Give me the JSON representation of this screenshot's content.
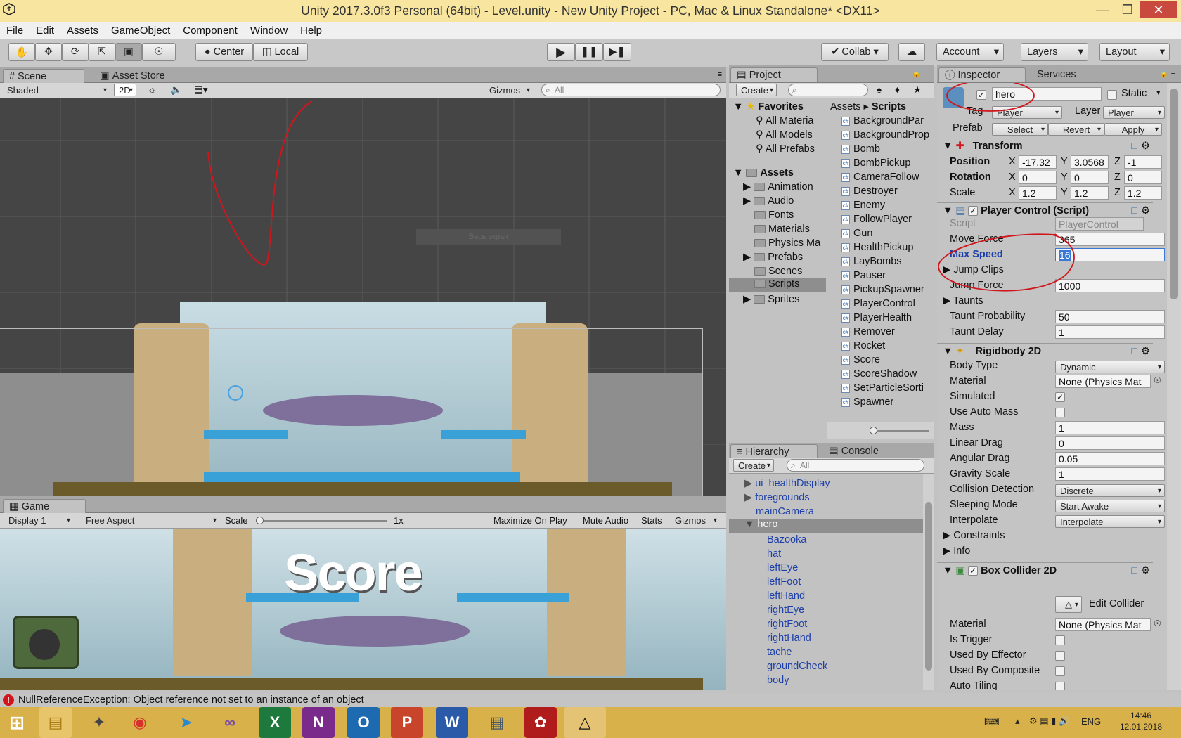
{
  "window": {
    "title": "Unity 2017.3.0f3 Personal (64bit) - Level.unity - New Unity Project - PC, Mac & Linux Standalone* <DX11>"
  },
  "menu": [
    "File",
    "Edit",
    "Assets",
    "GameObject",
    "Component",
    "Window",
    "Help"
  ],
  "toolbar": {
    "center": "Center",
    "local": "Local",
    "collab": "Collab",
    "account": "Account",
    "layers": "Layers",
    "layout": "Layout"
  },
  "scene": {
    "tab": "Scene",
    "asset_store": "Asset Store",
    "shading": "Shaded",
    "mode_2d": "2D",
    "gizmos": "Gizmos",
    "search": "All",
    "overlay_hint": "Весь экран"
  },
  "game": {
    "tab": "Game",
    "display": "Display 1",
    "aspect": "Free Aspect",
    "scale_label": "Scale",
    "scale_value": "1x",
    "maximize": "Maximize On Play",
    "mute": "Mute Audio",
    "stats": "Stats",
    "gizmos": "Gizmos",
    "score_text": "Score"
  },
  "project": {
    "tab": "Project",
    "create": "Create",
    "favorites_label": "Favorites",
    "favorites": [
      "All Materia",
      "All Models",
      "All Prefabs"
    ],
    "assets_label": "Assets",
    "folders": [
      {
        "name": "Animation",
        "arrow": true
      },
      {
        "name": "Audio",
        "arrow": true
      },
      {
        "name": "Fonts",
        "arrow": false
      },
      {
        "name": "Materials",
        "arrow": false
      },
      {
        "name": "Physics Ma",
        "arrow": false
      },
      {
        "name": "Prefabs",
        "arrow": true
      },
      {
        "name": "Scenes",
        "arrow": false
      },
      {
        "name": "Scripts",
        "arrow": false
      },
      {
        "name": "Sprites",
        "arrow": true
      }
    ],
    "breadcrumb_root": "Assets",
    "breadcrumb_current": "Scripts",
    "scripts": [
      "BackgroundPar",
      "BackgroundProp",
      "Bomb",
      "BombPickup",
      "CameraFollow",
      "Destroyer",
      "Enemy",
      "FollowPlayer",
      "Gun",
      "HealthPickup",
      "LayBombs",
      "Pauser",
      "PickupSpawner",
      "PlayerControl",
      "PlayerHealth",
      "Remover",
      "Rocket",
      "Score",
      "ScoreShadow",
      "SetParticleSorti",
      "Spawner"
    ]
  },
  "hierarchy": {
    "tab": "Hierarchy",
    "console_tab": "Console",
    "create": "Create",
    "search": "All",
    "items": [
      {
        "name": "ui_healthDisplay",
        "arrow": "▶",
        "indent": 0
      },
      {
        "name": "foregrounds",
        "arrow": "▶",
        "indent": 0
      },
      {
        "name": "mainCamera",
        "arrow": "",
        "indent": 0
      },
      {
        "name": "hero",
        "arrow": "▼",
        "indent": 0,
        "selected": true
      },
      {
        "name": "Bazooka",
        "arrow": "",
        "indent": 1
      },
      {
        "name": "hat",
        "arrow": "",
        "indent": 1
      },
      {
        "name": "leftEye",
        "arrow": "",
        "indent": 1
      },
      {
        "name": "leftFoot",
        "arrow": "",
        "indent": 1
      },
      {
        "name": "leftHand",
        "arrow": "",
        "indent": 1
      },
      {
        "name": "rightEye",
        "arrow": "",
        "indent": 1
      },
      {
        "name": "rightFoot",
        "arrow": "",
        "indent": 1
      },
      {
        "name": "rightHand",
        "arrow": "",
        "indent": 1
      },
      {
        "name": "tache",
        "arrow": "",
        "indent": 1
      },
      {
        "name": "groundCheck",
        "arrow": "",
        "indent": 1
      },
      {
        "name": "body",
        "arrow": "",
        "indent": 1
      }
    ]
  },
  "inspector": {
    "tab": "Inspector",
    "services_tab": "Services",
    "object_name": "hero",
    "static_label": "Static",
    "tag_label": "Tag",
    "tag_value": "Player",
    "layer_label": "Layer",
    "layer_value": "Player",
    "prefab_label": "Prefab",
    "prefab_select": "Select",
    "prefab_revert": "Revert",
    "prefab_apply": "Apply",
    "transform": {
      "title": "Transform",
      "position_label": "Position",
      "rotation_label": "Rotation",
      "scale_label": "Scale",
      "px": "-17.32",
      "py": "3.0568",
      "pz": "-1",
      "rx": "0",
      "ry": "0",
      "rz": "0",
      "sx": "1.2",
      "sy": "1.2",
      "sz": "1.2"
    },
    "player_control": {
      "title": "Player Control (Script)",
      "script_label": "Script",
      "script_value": "PlayerControl",
      "move_force_label": "Move Force",
      "move_force": "365",
      "max_speed_label": "Max Speed",
      "max_speed": "16",
      "jump_clips_label": "Jump Clips",
      "jump_force_label": "Jump Force",
      "jump_force": "1000",
      "taunts_label": "Taunts",
      "taunt_prob_label": "Taunt Probability",
      "taunt_prob": "50",
      "taunt_delay_label": "Taunt Delay",
      "taunt_delay": "1"
    },
    "rigidbody": {
      "title": "Rigidbody 2D",
      "body_type_label": "Body Type",
      "body_type": "Dynamic",
      "material_label": "Material",
      "material": "None (Physics Mat",
      "simulated_label": "Simulated",
      "auto_mass_label": "Use Auto Mass",
      "mass_label": "Mass",
      "mass": "1",
      "linear_drag_label": "Linear Drag",
      "linear_drag": "0",
      "angular_drag_label": "Angular Drag",
      "angular_drag": "0.05",
      "gravity_label": "Gravity Scale",
      "gravity": "1",
      "collision_label": "Collision Detection",
      "collision": "Discrete",
      "sleeping_label": "Sleeping Mode",
      "sleeping": "Start Awake",
      "interpolate_label": "Interpolate",
      "interpolate": "Interpolate",
      "constraints_label": "Constraints",
      "info_label": "Info"
    },
    "box_collider": {
      "title": "Box Collider 2D",
      "edit_collider": "Edit Collider",
      "material_label": "Material",
      "material": "None (Physics Mat",
      "is_trigger_label": "Is Trigger",
      "effector_label": "Used By Effector",
      "composite_label": "Used By Composite",
      "auto_tiling_label": "Auto Tiling"
    }
  },
  "status": {
    "error": "NullReferenceException: Object reference not set to an instance of an object"
  },
  "taskbar": {
    "time": "14:46",
    "date": "12.01.2018",
    "lang": "ENG"
  },
  "colors": {
    "accent": "#1d3fa8",
    "annotation": "#d0161c",
    "title_bg": "#f8e6a0",
    "taskbar": "#d8b14b"
  }
}
